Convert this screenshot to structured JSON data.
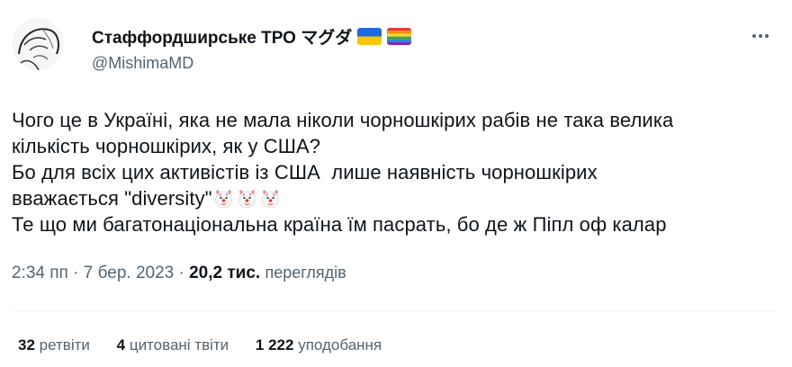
{
  "author": {
    "display_name": "Стаффордширське ТРО マグダ",
    "handle": "@MishimaMD",
    "flags": [
      "ukraine-flag",
      "rainbow-flag"
    ]
  },
  "tweet": {
    "line1": "Чого це в Україні, яка не мала ніколи чорношкірих рабів не така велика",
    "line2": "кількість чорношкірих, як у США?",
    "line3": "Бо для всіх цих активістів із США  лише наявність чорношкірих",
    "line4": "вважається \"diversity\"",
    "line5": "Те що ми багатонаціональна країна їм пасрать, бо де ж Піпл оф калар",
    "emoji": [
      "clown-face-icon",
      "clown-face-icon",
      "clown-face-icon"
    ]
  },
  "meta": {
    "time": "2:34 пп",
    "separator": "·",
    "date": "7 бер. 2023",
    "views_count": "20,2 тис.",
    "views_label": "переглядів"
  },
  "stats": {
    "retweets_count": "32",
    "retweets_label": "ретвіти",
    "quotes_count": "4",
    "quotes_label": "цитовані твіти",
    "likes_count": "1 222",
    "likes_label": "уподобання"
  },
  "colors": {
    "text": "#0f1419",
    "secondary": "#536471",
    "divider": "#eff3f4"
  }
}
